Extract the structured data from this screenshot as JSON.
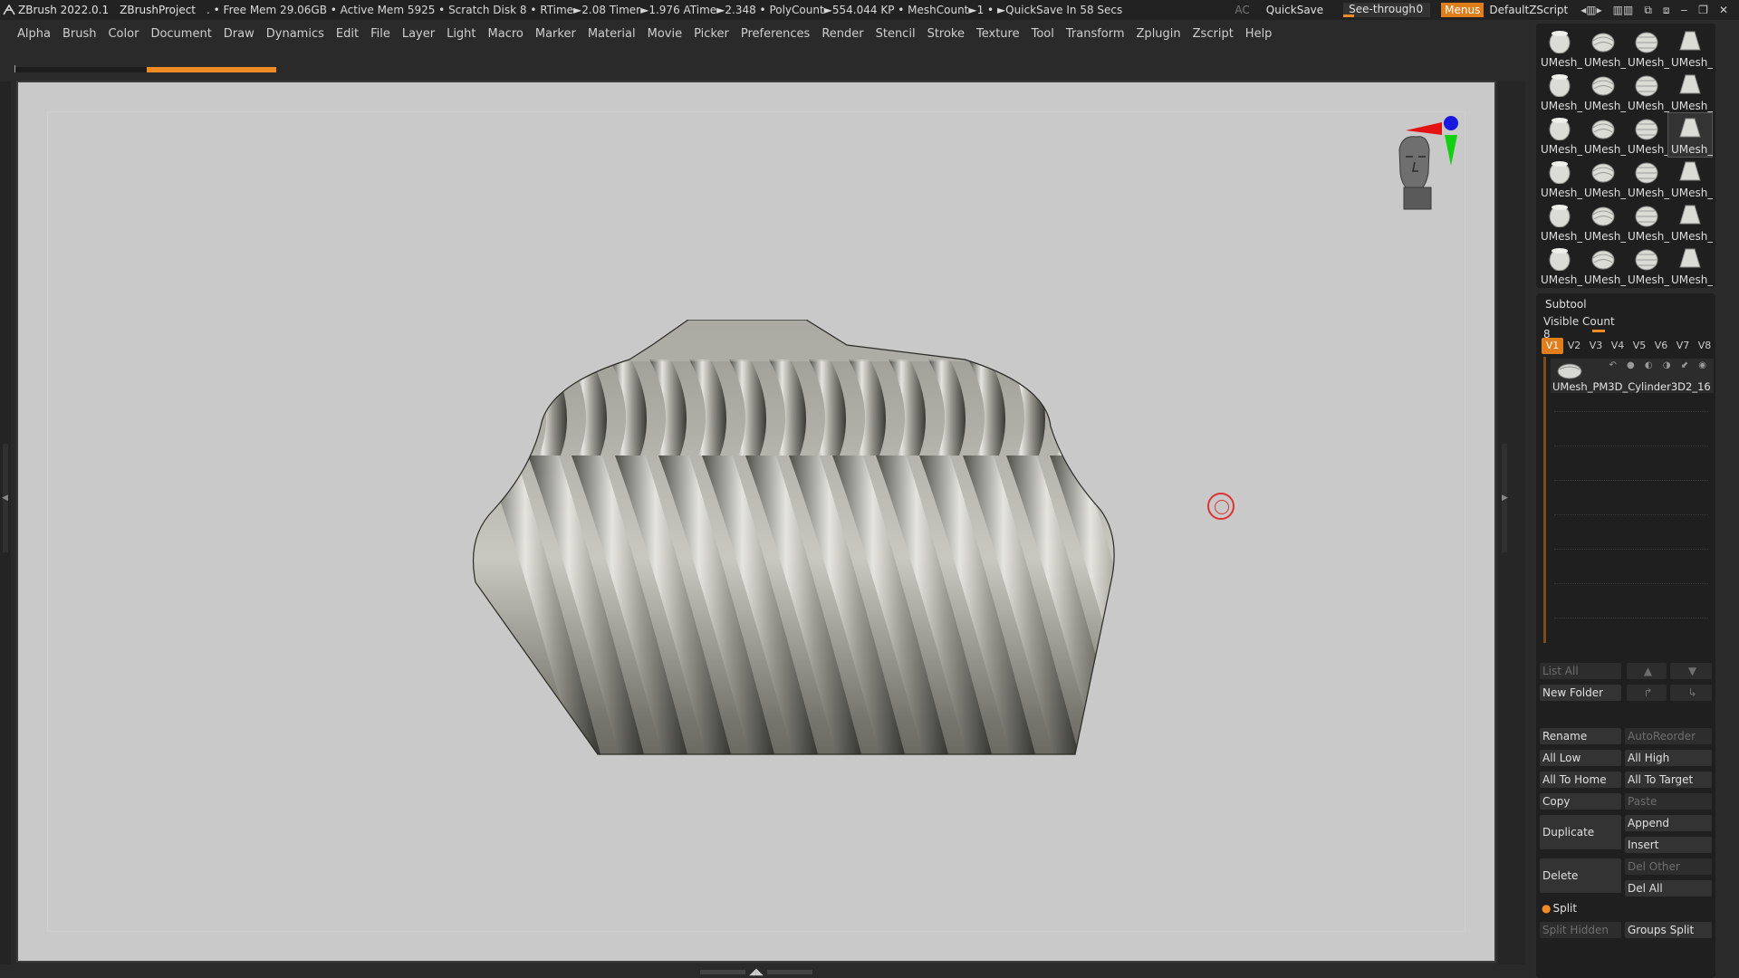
{
  "titlebar": {
    "app": "ZBrush 2022.0.1",
    "project": "ZBrushProject",
    "stats": ". • Free Mem 29.06GB • Active Mem 5925 • Scratch Disk 8 • RTime►2.08 Timer►1.976 ATime►2.348 • PolyCount►554.044 KP • MeshCount►1 • ►QuickSave In 58 Secs",
    "ac": "AC",
    "quicksave": "QuickSave",
    "see_through_label": "See-through",
    "see_through_value": "0",
    "menus": "Menus",
    "default_zscript": "DefaultZScript"
  },
  "menubar": [
    "Alpha",
    "Brush",
    "Color",
    "Document",
    "Draw",
    "Dynamics",
    "Edit",
    "File",
    "Layer",
    "Light",
    "Macro",
    "Marker",
    "Material",
    "Movie",
    "Picker",
    "Preferences",
    "Render",
    "Stencil",
    "Stroke",
    "Texture",
    "Tool",
    "Transform",
    "Zplugin",
    "Zscript",
    "Help"
  ],
  "tool_thumbs": {
    "label": "UMesh_",
    "count": 24,
    "selected_index": 11
  },
  "subtool": {
    "header": "Subtool",
    "visible_count_label": "Visible Count",
    "visible_count": "8",
    "views": [
      "V1",
      "V2",
      "V3",
      "V4",
      "V5",
      "V6",
      "V7",
      "V8"
    ],
    "active_view": "V1",
    "item_name": "UMesh_PM3D_Cylinder3D2_16",
    "buttons": {
      "list_all": "List All",
      "new_folder": "New Folder",
      "rename": "Rename",
      "auto_reorder": "AutoReorder",
      "all_low": "All Low",
      "all_high": "All High",
      "all_to_home": "All To Home",
      "all_to_target": "All To Target",
      "copy": "Copy",
      "paste": "Paste",
      "duplicate": "Duplicate",
      "append": "Append",
      "insert": "Insert",
      "delete": "Delete",
      "del_other": "Del Other",
      "del_all": "Del All",
      "split": "Split",
      "split_hidden": "Split Hidden",
      "groups_split": "Groups Split"
    }
  },
  "colors": {
    "accent": "#e07e1c",
    "canvas": "#c9c9c9",
    "panel": "#1f1f1f"
  },
  "icons": {
    "cursor": "brush-cursor-icon",
    "gizmo": "orientation-gizmo-icon"
  }
}
